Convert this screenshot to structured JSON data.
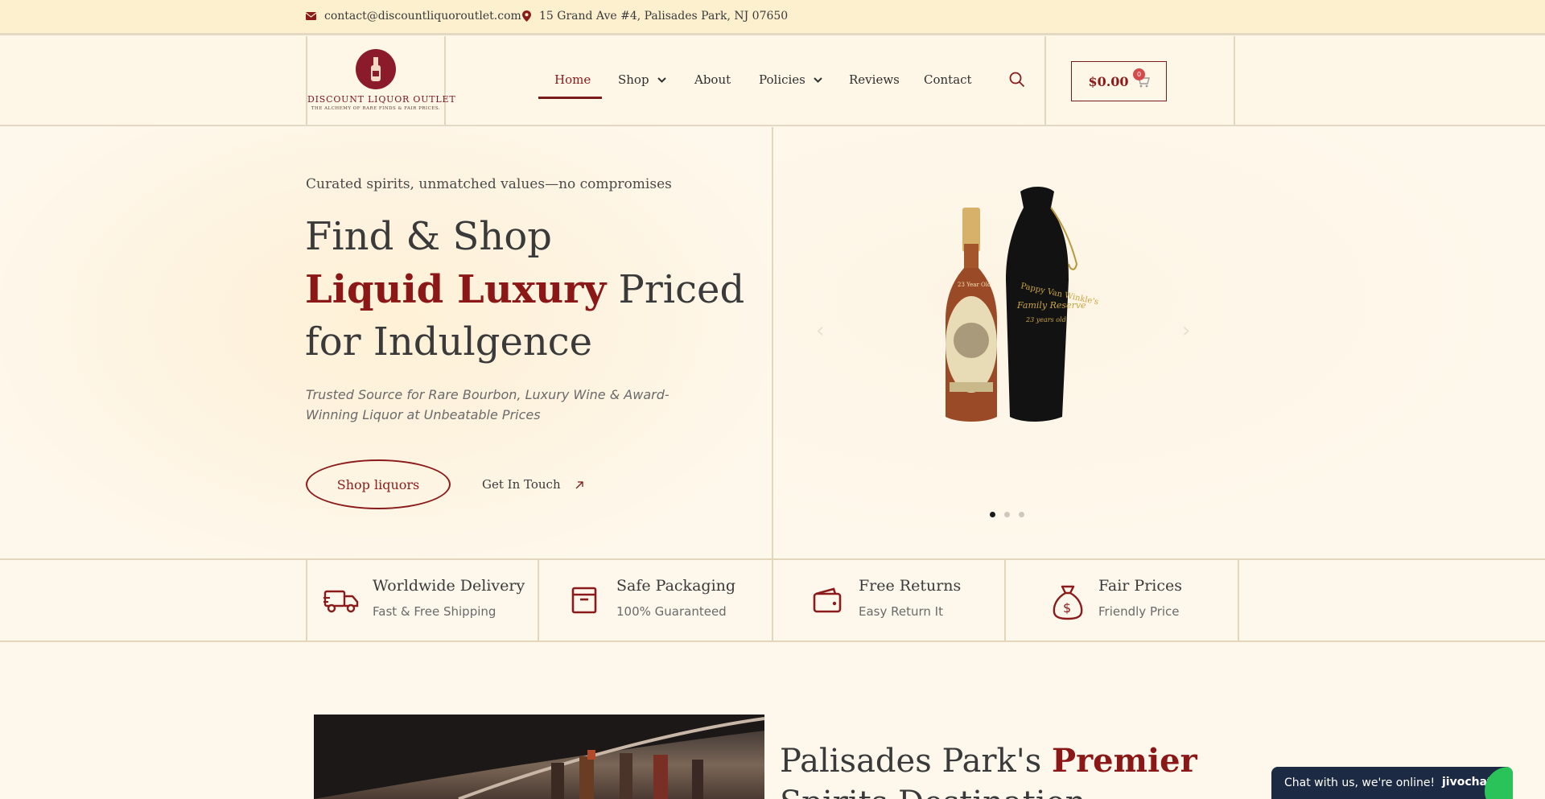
{
  "topbar": {
    "email": "contact@discountliquoroutlet.com",
    "address": "15 Grand Ave #4, Palisades Park, NJ 07650"
  },
  "header": {
    "logo_name": "DISCOUNT LIQUOR OUTLET",
    "logo_tagline": "THE ALCHEMY OF RARE FINDS & FAIR PRICES.",
    "nav": {
      "home": "Home",
      "shop": "Shop",
      "about": "About",
      "policies": "Policies",
      "reviews": "Reviews",
      "contact": "Contact"
    },
    "cart_total": "$0.00",
    "cart_count": "0"
  },
  "hero": {
    "subtitle": "Curated spirits, unmatched values—no compromises",
    "line1": "Find & Shop",
    "line2_highlight": "Liquid Luxury",
    "line2_rest": " Priced",
    "line3": "for Indulgence",
    "description": "Trusted Source for Rare Bourbon, Luxury Wine & Award-Winning Liquor at Unbeatable Prices",
    "shop_button": "Shop liquors",
    "touch_button": "Get In Touch",
    "slider_dots": 3,
    "active_dot": 1,
    "product_label_top": "23 Year Old",
    "product_brand": "Pappy Van Winkle's",
    "product_line": "Family Reserve",
    "bag_age": "23 years old"
  },
  "features": [
    {
      "title": "Worldwide Delivery",
      "subtitle": "Fast & Free Shipping",
      "icon": "truck-icon"
    },
    {
      "title": "Safe Packaging",
      "subtitle": "100% Guaranteed",
      "icon": "box-icon"
    },
    {
      "title": "Free Returns",
      "subtitle": "Easy Return It",
      "icon": "wallet-icon"
    },
    {
      "title": "Fair Prices",
      "subtitle": "Friendly Price",
      "icon": "money-bag-icon"
    }
  ],
  "section2": {
    "heading_plain": "Palisades Park's ",
    "heading_highlight": "Premier",
    "heading_line2": "Spirits Destination"
  },
  "chat": {
    "text": "Chat with us, we're online!",
    "brand": "jivochat"
  },
  "colors": {
    "accent": "#8b1717",
    "topbar_bg": "#fdf0cf",
    "page_bg": "#fef8ec",
    "chat_bg": "#1d2a43"
  }
}
